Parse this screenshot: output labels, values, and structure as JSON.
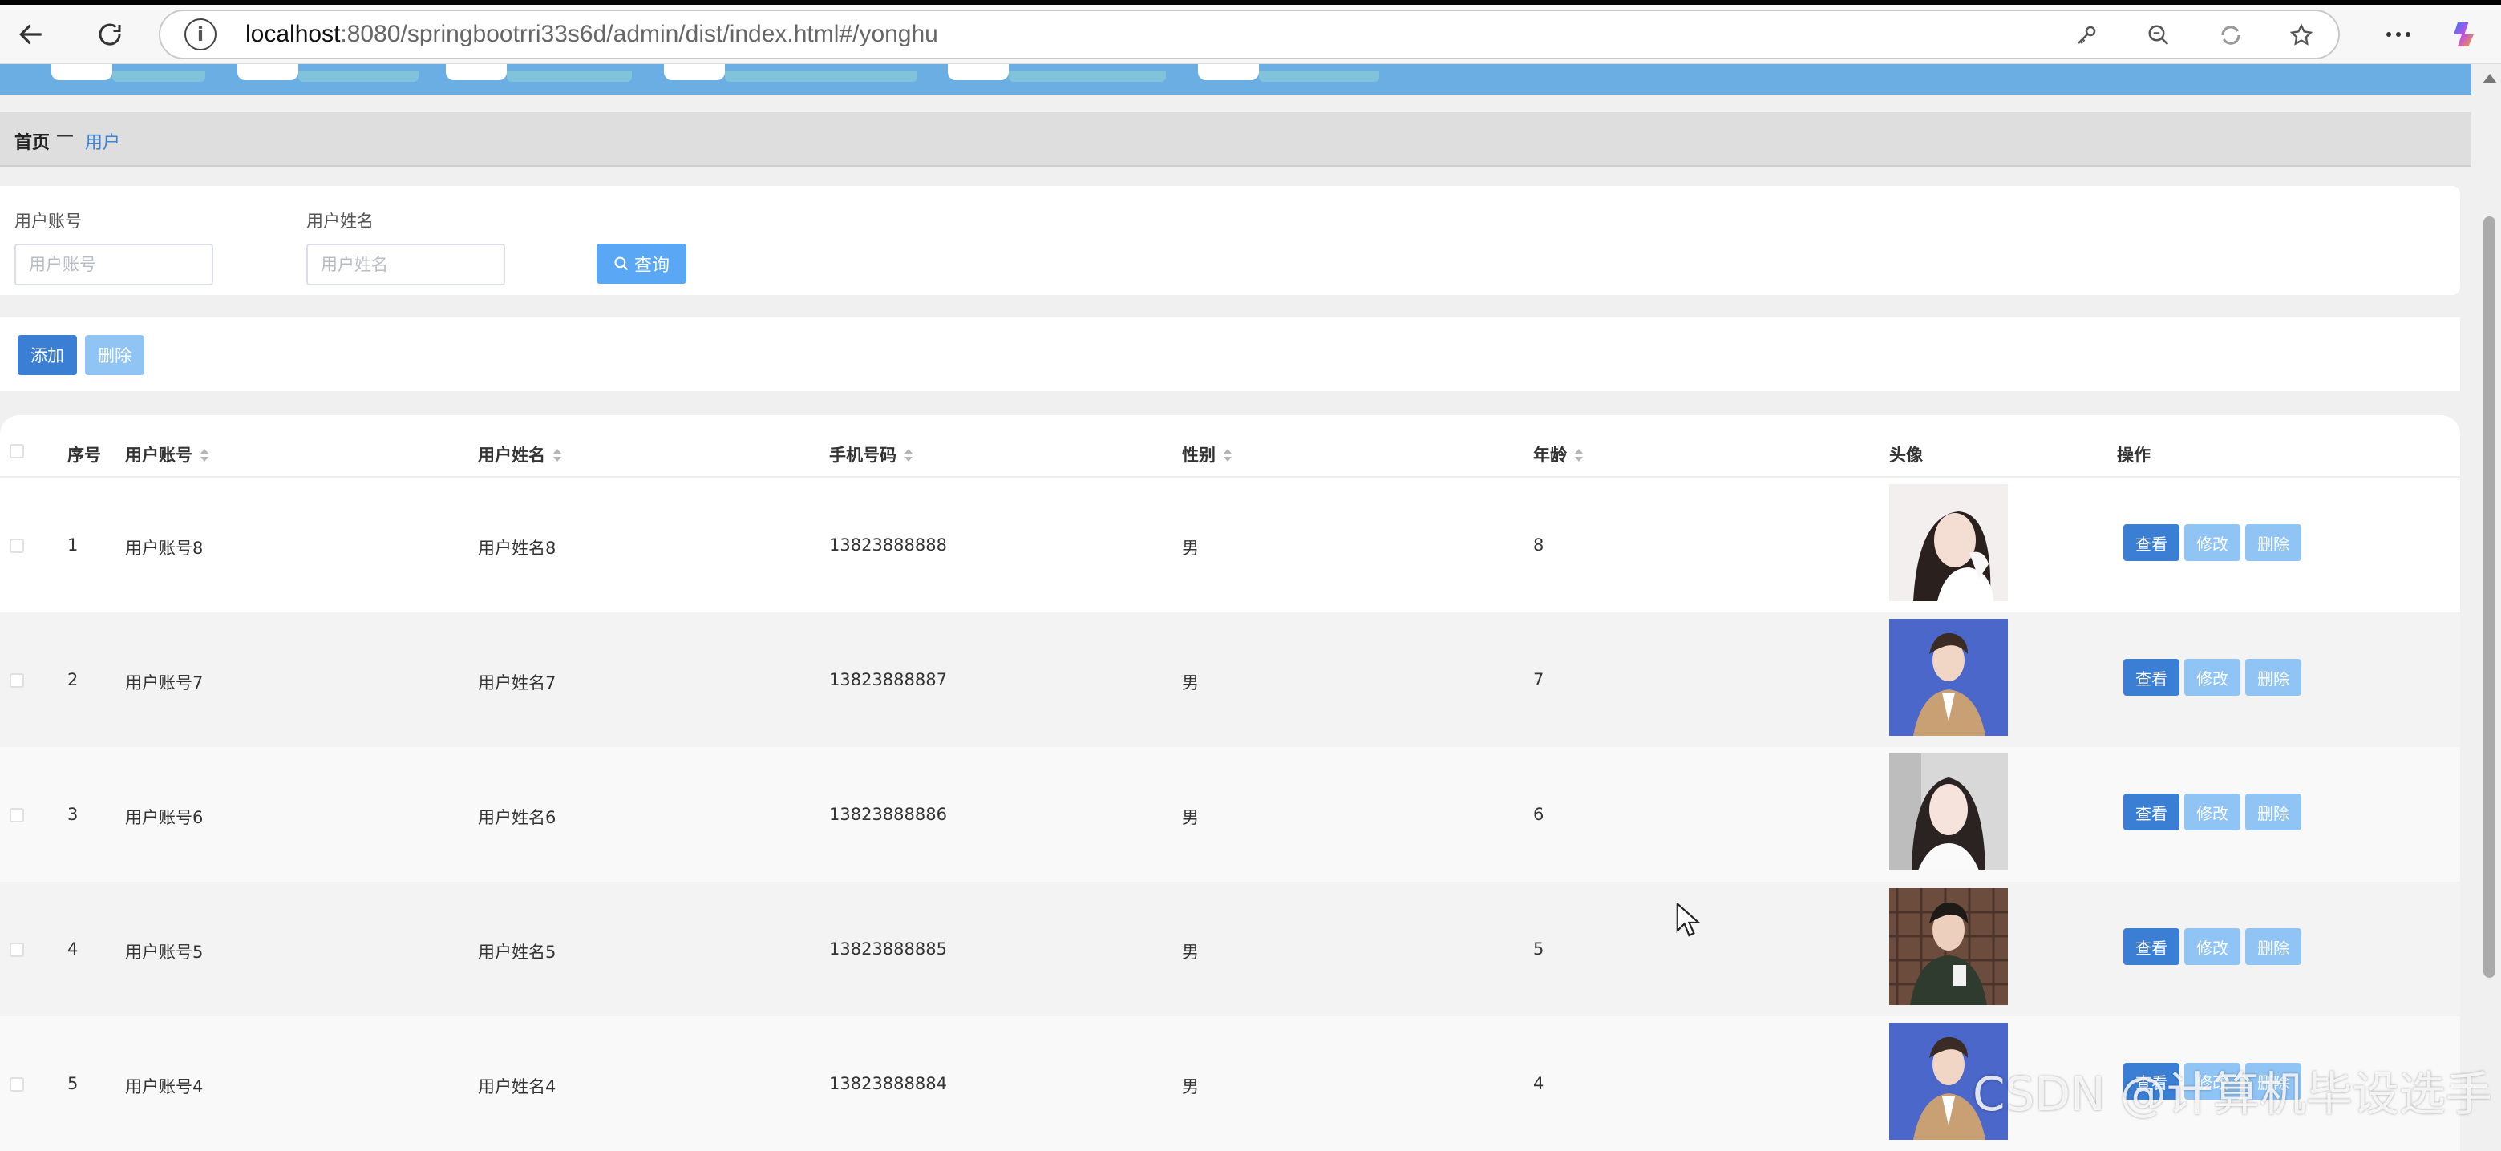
{
  "browser": {
    "url_host": "localhost",
    "url_path": ":8080/springbootrri33s6d/admin/dist/index.html#/yonghu"
  },
  "breadcrumb": {
    "home": "首页",
    "separator": "—",
    "current": "用户"
  },
  "search": {
    "account_label": "用户账号",
    "account_placeholder": "用户账号",
    "name_label": "用户姓名",
    "name_placeholder": "用户姓名",
    "button_label": "查询"
  },
  "actions": {
    "add_label": "添加",
    "delete_label": "删除"
  },
  "table": {
    "headers": {
      "index": "序号",
      "account": "用户账号",
      "name": "用户姓名",
      "phone": "手机号码",
      "gender": "性别",
      "age": "年龄",
      "avatar": "头像",
      "operation": "操作"
    },
    "row_buttons": {
      "view": "查看",
      "edit": "修改",
      "delete": "删除"
    },
    "rows": [
      {
        "index": "1",
        "account": "用户账号8",
        "name": "用户姓名8",
        "phone": "13823888888",
        "gender": "男",
        "age": "8"
      },
      {
        "index": "2",
        "account": "用户账号7",
        "name": "用户姓名7",
        "phone": "13823888887",
        "gender": "男",
        "age": "7"
      },
      {
        "index": "3",
        "account": "用户账号6",
        "name": "用户姓名6",
        "phone": "13823888886",
        "gender": "男",
        "age": "6"
      },
      {
        "index": "4",
        "account": "用户账号5",
        "name": "用户姓名5",
        "phone": "13823888885",
        "gender": "男",
        "age": "5"
      },
      {
        "index": "5",
        "account": "用户账号4",
        "name": "用户姓名4",
        "phone": "13823888884",
        "gender": "男",
        "age": "4"
      }
    ]
  },
  "watermark": "CSDN @计算机毕设选手",
  "colors": {
    "primary": "#3b7fd4",
    "primary_light": "#8fc4f5",
    "header_strip": "#6aaee4",
    "link": "#3a84d8"
  }
}
